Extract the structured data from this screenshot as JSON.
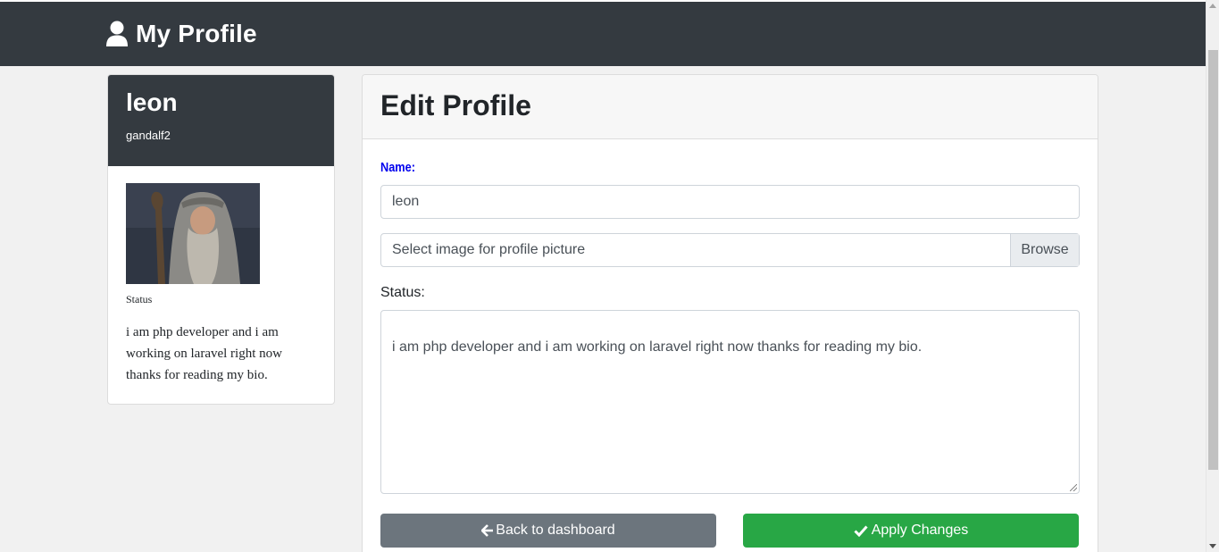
{
  "header": {
    "title": "My Profile",
    "icon": "user-icon"
  },
  "user_card": {
    "name": "leon",
    "username": "gandalf2",
    "avatar": "profile-photo",
    "status_label": "Status",
    "bio": "i am php developer and i am working on laravel right now thanks for reading my bio."
  },
  "edit_profile": {
    "title": "Edit Profile",
    "name_label": "Name:",
    "name_value": "leon",
    "file_placeholder": "Select image for profile picture",
    "browse_label": "Browse",
    "status_label": "Status:",
    "status_value": "i am php developer and i am working on laravel right now thanks for reading my bio.",
    "back_button": "Back to dashboard",
    "apply_button": "Apply Changes"
  },
  "colors": {
    "header_bg": "#343a40",
    "name_label": "#0000ee",
    "back_button": "#6c757d",
    "apply_button": "#28a745"
  }
}
